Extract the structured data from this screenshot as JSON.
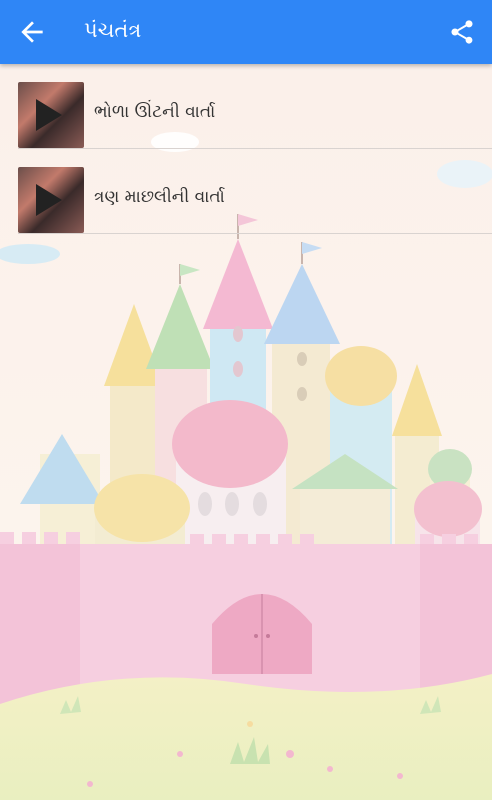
{
  "appbar": {
    "title": "પંચતંત્ર",
    "back_icon": "arrow-back-icon",
    "share_icon": "share-icon",
    "color": "#2f86f6"
  },
  "list": {
    "items": [
      {
        "label": "ભોળા ઊંટની વાર્તા",
        "icon": "play-icon"
      },
      {
        "label": "ત્રણ માછલીની વાર્તા",
        "icon": "play-icon"
      }
    ]
  }
}
